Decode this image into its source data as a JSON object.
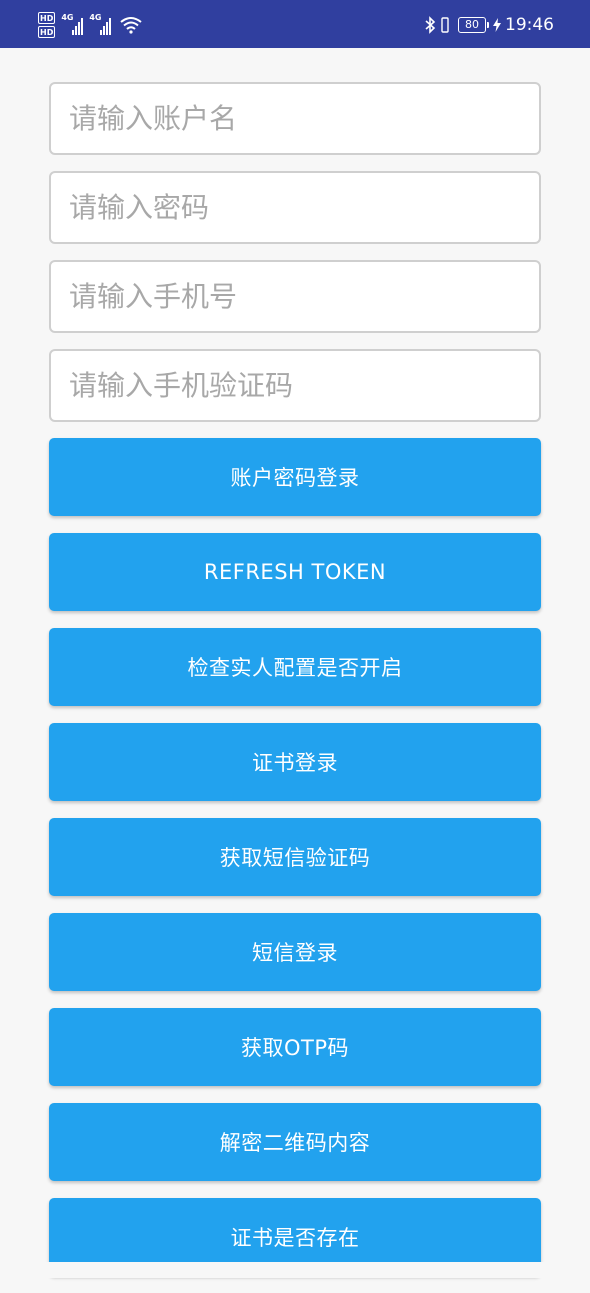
{
  "status_bar": {
    "left_badges": [
      "HD",
      "HD"
    ],
    "network_1": "4G",
    "network_2": "4G",
    "battery_level": "80",
    "time": "19:46",
    "icons": [
      "hd-icon",
      "signal-icon",
      "wifi-icon",
      "bluetooth-icon",
      "vibrate-icon",
      "battery-icon",
      "charging-icon"
    ]
  },
  "form": {
    "account_placeholder": "请输入账户名",
    "password_placeholder": "请输入密码",
    "phone_placeholder": "请输入手机号",
    "sms_code_placeholder": "请输入手机验证码"
  },
  "buttons": [
    "账户密码登录",
    "REFRESH TOKEN",
    "检查实人配置是否开启",
    "证书登录",
    "获取短信验证码",
    "短信登录",
    "获取OTP码",
    "解密二维码内容",
    "证书是否存在"
  ],
  "colors": {
    "status_bar": "#303f9f",
    "button": "#22a2ee",
    "background": "#f7f7f7"
  }
}
